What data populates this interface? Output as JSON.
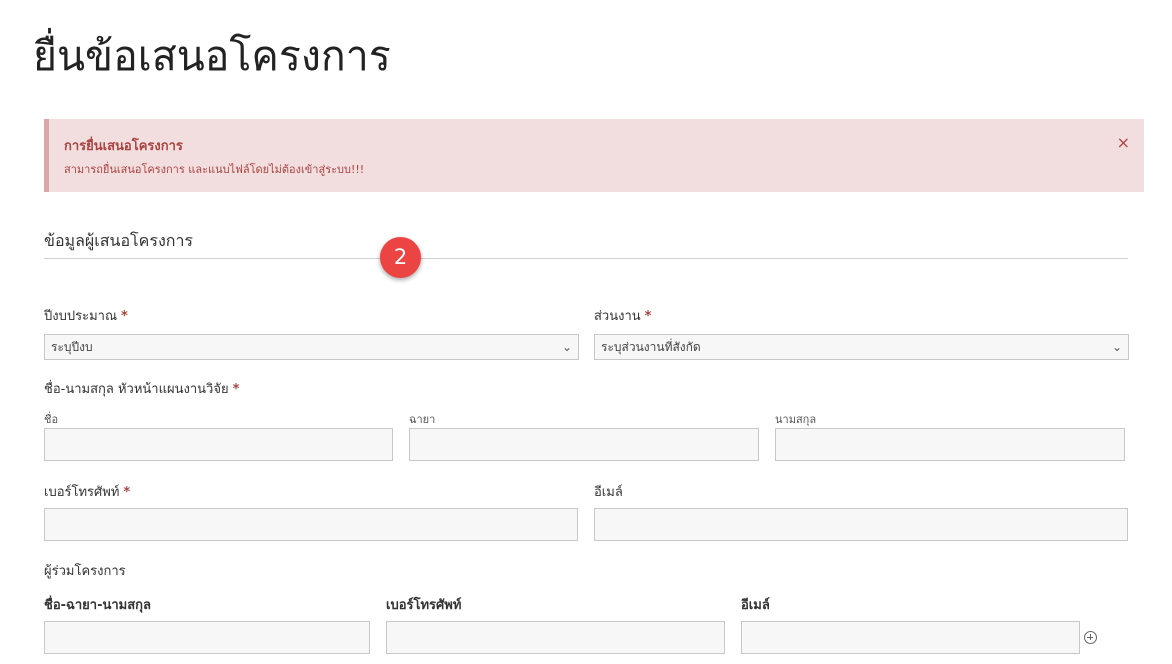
{
  "page": {
    "title": "ยื่นข้อเสนอโครงการ"
  },
  "alert": {
    "title": "การยื่นเสนอโครงการ",
    "text": "สามารถยื่นเสนอโครงการ และแนบไฟล์โดยไม่ต้องเข้าสู่ระบบ!!!",
    "close": "×"
  },
  "section": {
    "title": "ข้อมูลผู้เสนอโครงการ",
    "step_badge": "2"
  },
  "fields": {
    "budget_year": {
      "label": "ปีงบประมาณ",
      "required": "*",
      "selected": "ระบุปีงบ"
    },
    "department": {
      "label": "ส่วนงาน",
      "required": "*",
      "selected": "ระบุส่วนงานที่สังกัด"
    },
    "head_name": {
      "label": "ชื่อ-นามสกุล หัวหน้าแผนงานวิจัย",
      "required": "*",
      "first_name": "ชื่อ",
      "title": "ฉายา",
      "last_name": "นามสกุล"
    },
    "phone": {
      "label": "เบอร์โทรศัพท์",
      "required": "*"
    },
    "email": {
      "label": "อีเมล์"
    }
  },
  "co_researchers": {
    "label": "ผู้ร่วมโครงการ",
    "columns": [
      "ชื่อ-ฉายา-นามสกุล",
      "เบอร์โทรศัพท์",
      "อีเมล์"
    ],
    "add_icon": "plus-circle-icon"
  }
}
